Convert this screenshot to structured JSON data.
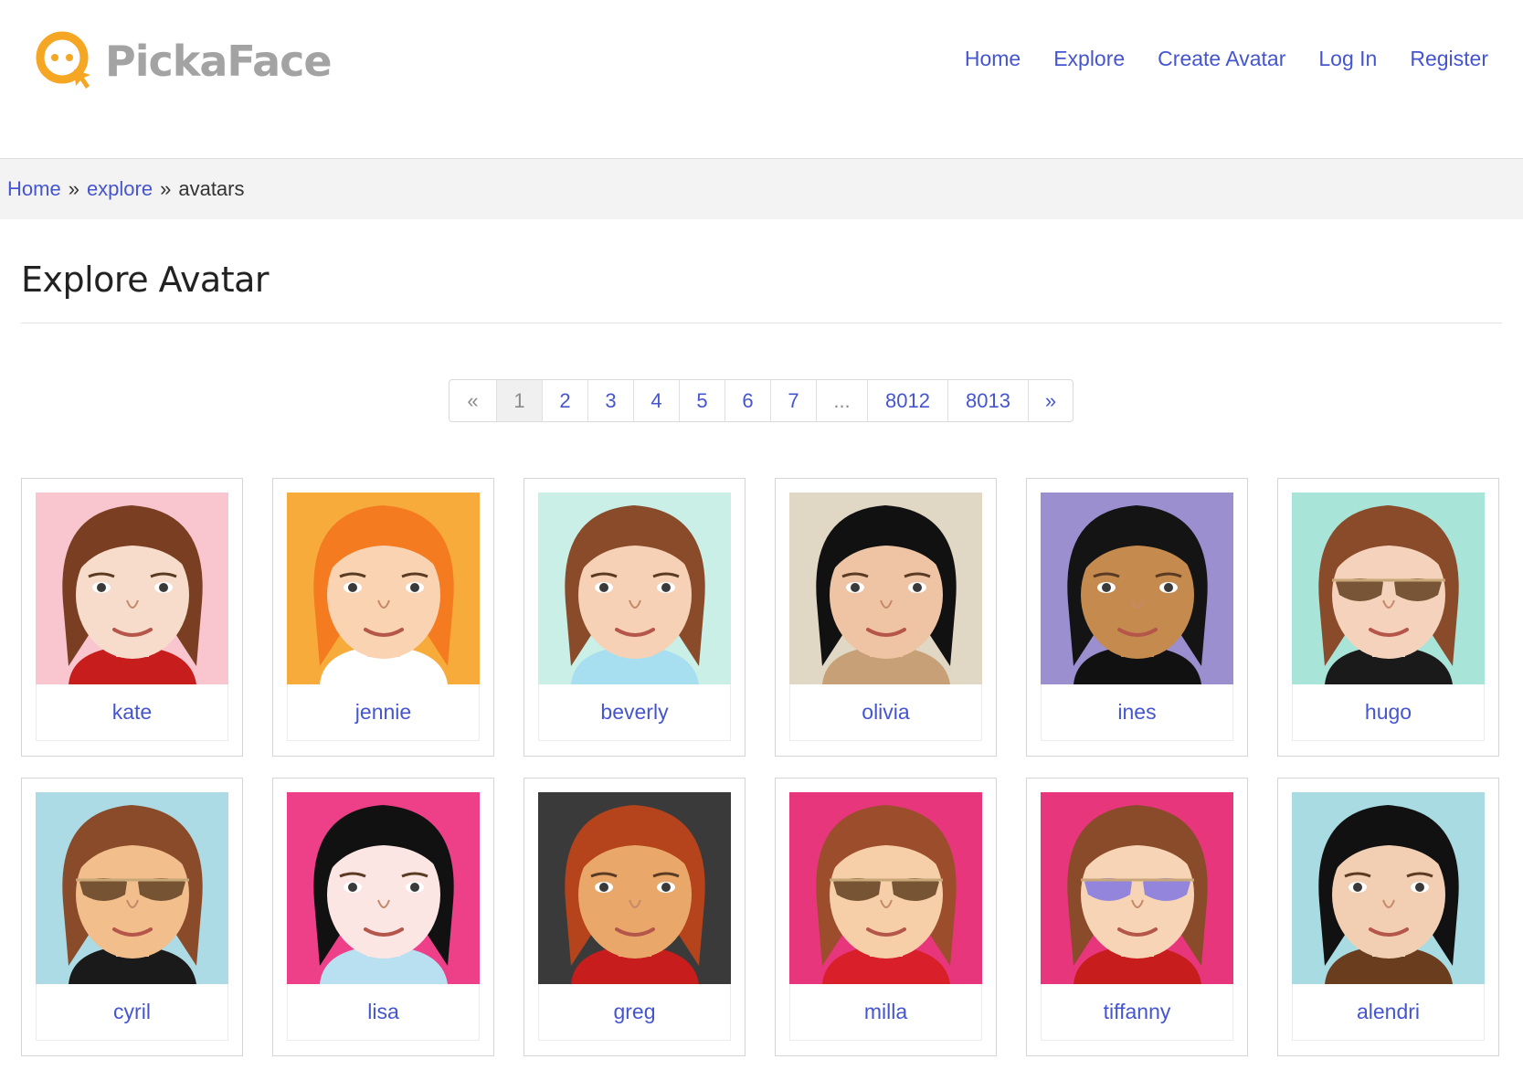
{
  "brand": {
    "name": "PickaFace",
    "orange": "#f5a623",
    "gray": "#a3a3a3"
  },
  "nav": {
    "items": [
      {
        "label": "Home"
      },
      {
        "label": "Explore"
      },
      {
        "label": "Create Avatar"
      },
      {
        "label": "Log In"
      },
      {
        "label": "Register"
      }
    ]
  },
  "breadcrumb": {
    "home": "Home",
    "explore": "explore",
    "current": "avatars",
    "separator": "»"
  },
  "page": {
    "title": "Explore Avatar"
  },
  "pagination": {
    "prev": "«",
    "pages": [
      "1",
      "2",
      "3",
      "4",
      "5",
      "6",
      "7"
    ],
    "ellipsis": "...",
    "last_pages": [
      "8012",
      "8013"
    ],
    "next": "»",
    "current": "1"
  },
  "avatars": [
    {
      "name": "kate",
      "bg": "#f9c6cf",
      "hair": "#7a3f22",
      "skin": "#f7dccb",
      "shirt": "#c81d1d",
      "glasses": "none"
    },
    {
      "name": "jennie",
      "bg": "#f7ab3b",
      "hair": "#f47b20",
      "skin": "#f9d3b2",
      "shirt": "#ffffff",
      "glasses": "none"
    },
    {
      "name": "beverly",
      "bg": "#c9efe7",
      "hair": "#8a4b2a",
      "skin": "#f7d1b5",
      "shirt": "#a8dff0",
      "glasses": "none"
    },
    {
      "name": "olivia",
      "bg": "#e0d8c4",
      "hair": "#111111",
      "skin": "#efc4a4",
      "shirt": "#c8a078",
      "glasses": "none"
    },
    {
      "name": "ines",
      "bg": "#9c8fd0",
      "hair": "#141414",
      "skin": "#c48a4e",
      "shirt": "#111111",
      "glasses": "none"
    },
    {
      "name": "hugo",
      "bg": "#a9e4d9",
      "hair": "#8a4b2a",
      "skin": "#f5d2bc",
      "shirt": "#1a1a1a",
      "glasses": "brown"
    },
    {
      "name": "cyril",
      "bg": "#addbe5",
      "hair": "#8a4b2a",
      "skin": "#f2be8c",
      "shirt": "#1a1a1a",
      "glasses": "brown"
    },
    {
      "name": "lisa",
      "bg": "#ee3f89",
      "hair": "#111111",
      "skin": "#fbe6e4",
      "shirt": "#b8e0f0",
      "glasses": "none"
    },
    {
      "name": "greg",
      "bg": "#3a3a3a",
      "hair": "#b5441c",
      "skin": "#e9a86a",
      "shirt": "#c81d1d",
      "glasses": "none"
    },
    {
      "name": "milla",
      "bg": "#e8367c",
      "hair": "#9c4e2c",
      "skin": "#f6cfa8",
      "shirt": "#d81f2a",
      "glasses": "brown"
    },
    {
      "name": "tiffanny",
      "bg": "#e8367c",
      "hair": "#8a4b2a",
      "skin": "#f8d4b6",
      "shirt": "#c81d1d",
      "glasses": "purple"
    },
    {
      "name": "alendri",
      "bg": "#a9dbe3",
      "hair": "#111111",
      "skin": "#f2cfb2",
      "shirt": "#6b3d1f",
      "glasses": "none"
    }
  ]
}
